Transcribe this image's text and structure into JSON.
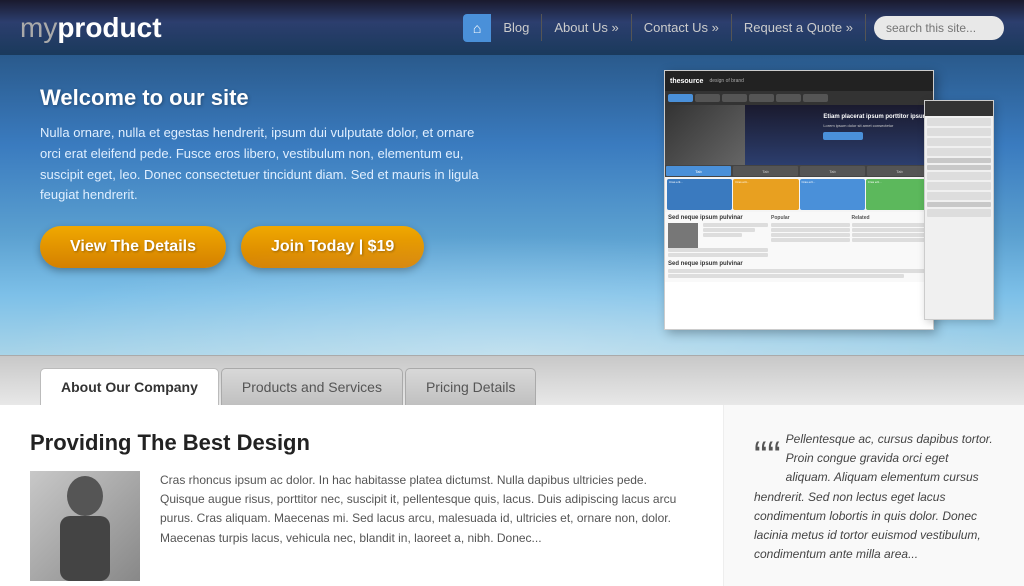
{
  "header": {
    "logo": {
      "my": "my",
      "product": "product"
    },
    "nav": {
      "home_icon": "⌂",
      "items": [
        {
          "label": "Blog",
          "has_arrow": false
        },
        {
          "label": "About Us »",
          "has_arrow": true
        },
        {
          "label": "Contact Us »",
          "has_arrow": true
        },
        {
          "label": "Request a Quote »",
          "has_arrow": true
        }
      ]
    },
    "search_placeholder": "search this site..."
  },
  "hero": {
    "title": "Welcome to our site",
    "description": "Nulla ornare, nulla et egestas hendrerit, ipsum dui vulputate dolor, et ornare orci erat eleifend pede. Fusce eros libero, vestibulum non, elementum eu, suscipit eget, leo. Donec consectetuer tincidunt diam. Sed et mauris in ligula feugiat hendrerit.",
    "btn_details": "View The Details",
    "btn_join": "Join Today | $19"
  },
  "screenshot": {
    "site_title": "thesource",
    "tagline": "design of brand",
    "hero_title": "Etiam placerat ipsum porttitor ipsum",
    "hero_desc": "Lorem ipsum dolor sit amet consectetur",
    "section_title": "Sed neque ipsum pulvinar",
    "section_title2": "Sed neque ipsum pulvinar"
  },
  "tabs": {
    "items": [
      {
        "label": "About Our Company",
        "active": true
      },
      {
        "label": "Products and Services",
        "active": false
      },
      {
        "label": "Pricing Details",
        "active": false
      }
    ]
  },
  "content": {
    "main": {
      "heading": "Providing The Best Design",
      "text": "Cras rhoncus ipsum ac dolor. In hac habitasse platea dictumst. Nulla dapibus ultricies pede. Quisque augue risus, porttitor nec, suscipit it, pellentesque quis, lacus. Duis adipiscing lacus arcu purus. Cras aliquam. Maecenas mi. Sed lacus arcu, malesuada id, ultricies et, ornare non, dolor. Maecenas turpis lacus, vehicula nec, blandit in, laoreet a, nibh. Donec..."
    },
    "quote": {
      "mark": "““",
      "text": "Pellentesque ac, cursus dapibus tortor. Proin congue gravida orci eget aliquam. Aliquam elementum cursus hendrerit. Sed non lectus eget lacus condimentum lobortis in quis dolor. Donec lacinia metus id tortor euismod vestibulum, condimentum ante milla area..."
    }
  }
}
